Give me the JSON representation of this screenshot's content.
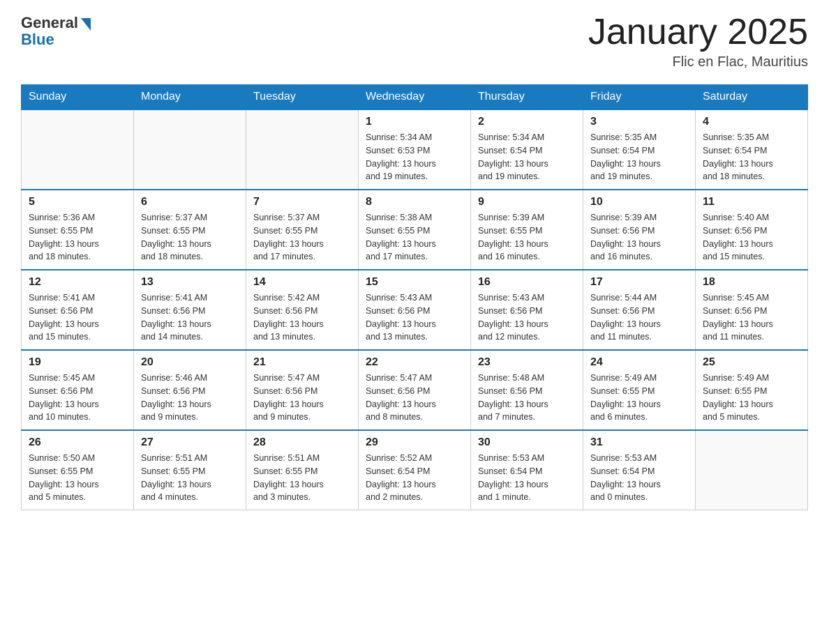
{
  "logo": {
    "general": "General",
    "blue": "Blue"
  },
  "title": "January 2025",
  "location": "Flic en Flac, Mauritius",
  "days_of_week": [
    "Sunday",
    "Monday",
    "Tuesday",
    "Wednesday",
    "Thursday",
    "Friday",
    "Saturday"
  ],
  "weeks": [
    [
      {
        "day": "",
        "info": ""
      },
      {
        "day": "",
        "info": ""
      },
      {
        "day": "",
        "info": ""
      },
      {
        "day": "1",
        "info": "Sunrise: 5:34 AM\nSunset: 6:53 PM\nDaylight: 13 hours\nand 19 minutes."
      },
      {
        "day": "2",
        "info": "Sunrise: 5:34 AM\nSunset: 6:54 PM\nDaylight: 13 hours\nand 19 minutes."
      },
      {
        "day": "3",
        "info": "Sunrise: 5:35 AM\nSunset: 6:54 PM\nDaylight: 13 hours\nand 19 minutes."
      },
      {
        "day": "4",
        "info": "Sunrise: 5:35 AM\nSunset: 6:54 PM\nDaylight: 13 hours\nand 18 minutes."
      }
    ],
    [
      {
        "day": "5",
        "info": "Sunrise: 5:36 AM\nSunset: 6:55 PM\nDaylight: 13 hours\nand 18 minutes."
      },
      {
        "day": "6",
        "info": "Sunrise: 5:37 AM\nSunset: 6:55 PM\nDaylight: 13 hours\nand 18 minutes."
      },
      {
        "day": "7",
        "info": "Sunrise: 5:37 AM\nSunset: 6:55 PM\nDaylight: 13 hours\nand 17 minutes."
      },
      {
        "day": "8",
        "info": "Sunrise: 5:38 AM\nSunset: 6:55 PM\nDaylight: 13 hours\nand 17 minutes."
      },
      {
        "day": "9",
        "info": "Sunrise: 5:39 AM\nSunset: 6:55 PM\nDaylight: 13 hours\nand 16 minutes."
      },
      {
        "day": "10",
        "info": "Sunrise: 5:39 AM\nSunset: 6:56 PM\nDaylight: 13 hours\nand 16 minutes."
      },
      {
        "day": "11",
        "info": "Sunrise: 5:40 AM\nSunset: 6:56 PM\nDaylight: 13 hours\nand 15 minutes."
      }
    ],
    [
      {
        "day": "12",
        "info": "Sunrise: 5:41 AM\nSunset: 6:56 PM\nDaylight: 13 hours\nand 15 minutes."
      },
      {
        "day": "13",
        "info": "Sunrise: 5:41 AM\nSunset: 6:56 PM\nDaylight: 13 hours\nand 14 minutes."
      },
      {
        "day": "14",
        "info": "Sunrise: 5:42 AM\nSunset: 6:56 PM\nDaylight: 13 hours\nand 13 minutes."
      },
      {
        "day": "15",
        "info": "Sunrise: 5:43 AM\nSunset: 6:56 PM\nDaylight: 13 hours\nand 13 minutes."
      },
      {
        "day": "16",
        "info": "Sunrise: 5:43 AM\nSunset: 6:56 PM\nDaylight: 13 hours\nand 12 minutes."
      },
      {
        "day": "17",
        "info": "Sunrise: 5:44 AM\nSunset: 6:56 PM\nDaylight: 13 hours\nand 11 minutes."
      },
      {
        "day": "18",
        "info": "Sunrise: 5:45 AM\nSunset: 6:56 PM\nDaylight: 13 hours\nand 11 minutes."
      }
    ],
    [
      {
        "day": "19",
        "info": "Sunrise: 5:45 AM\nSunset: 6:56 PM\nDaylight: 13 hours\nand 10 minutes."
      },
      {
        "day": "20",
        "info": "Sunrise: 5:46 AM\nSunset: 6:56 PM\nDaylight: 13 hours\nand 9 minutes."
      },
      {
        "day": "21",
        "info": "Sunrise: 5:47 AM\nSunset: 6:56 PM\nDaylight: 13 hours\nand 9 minutes."
      },
      {
        "day": "22",
        "info": "Sunrise: 5:47 AM\nSunset: 6:56 PM\nDaylight: 13 hours\nand 8 minutes."
      },
      {
        "day": "23",
        "info": "Sunrise: 5:48 AM\nSunset: 6:56 PM\nDaylight: 13 hours\nand 7 minutes."
      },
      {
        "day": "24",
        "info": "Sunrise: 5:49 AM\nSunset: 6:55 PM\nDaylight: 13 hours\nand 6 minutes."
      },
      {
        "day": "25",
        "info": "Sunrise: 5:49 AM\nSunset: 6:55 PM\nDaylight: 13 hours\nand 5 minutes."
      }
    ],
    [
      {
        "day": "26",
        "info": "Sunrise: 5:50 AM\nSunset: 6:55 PM\nDaylight: 13 hours\nand 5 minutes."
      },
      {
        "day": "27",
        "info": "Sunrise: 5:51 AM\nSunset: 6:55 PM\nDaylight: 13 hours\nand 4 minutes."
      },
      {
        "day": "28",
        "info": "Sunrise: 5:51 AM\nSunset: 6:55 PM\nDaylight: 13 hours\nand 3 minutes."
      },
      {
        "day": "29",
        "info": "Sunrise: 5:52 AM\nSunset: 6:54 PM\nDaylight: 13 hours\nand 2 minutes."
      },
      {
        "day": "30",
        "info": "Sunrise: 5:53 AM\nSunset: 6:54 PM\nDaylight: 13 hours\nand 1 minute."
      },
      {
        "day": "31",
        "info": "Sunrise: 5:53 AM\nSunset: 6:54 PM\nDaylight: 13 hours\nand 0 minutes."
      },
      {
        "day": "",
        "info": ""
      }
    ]
  ]
}
